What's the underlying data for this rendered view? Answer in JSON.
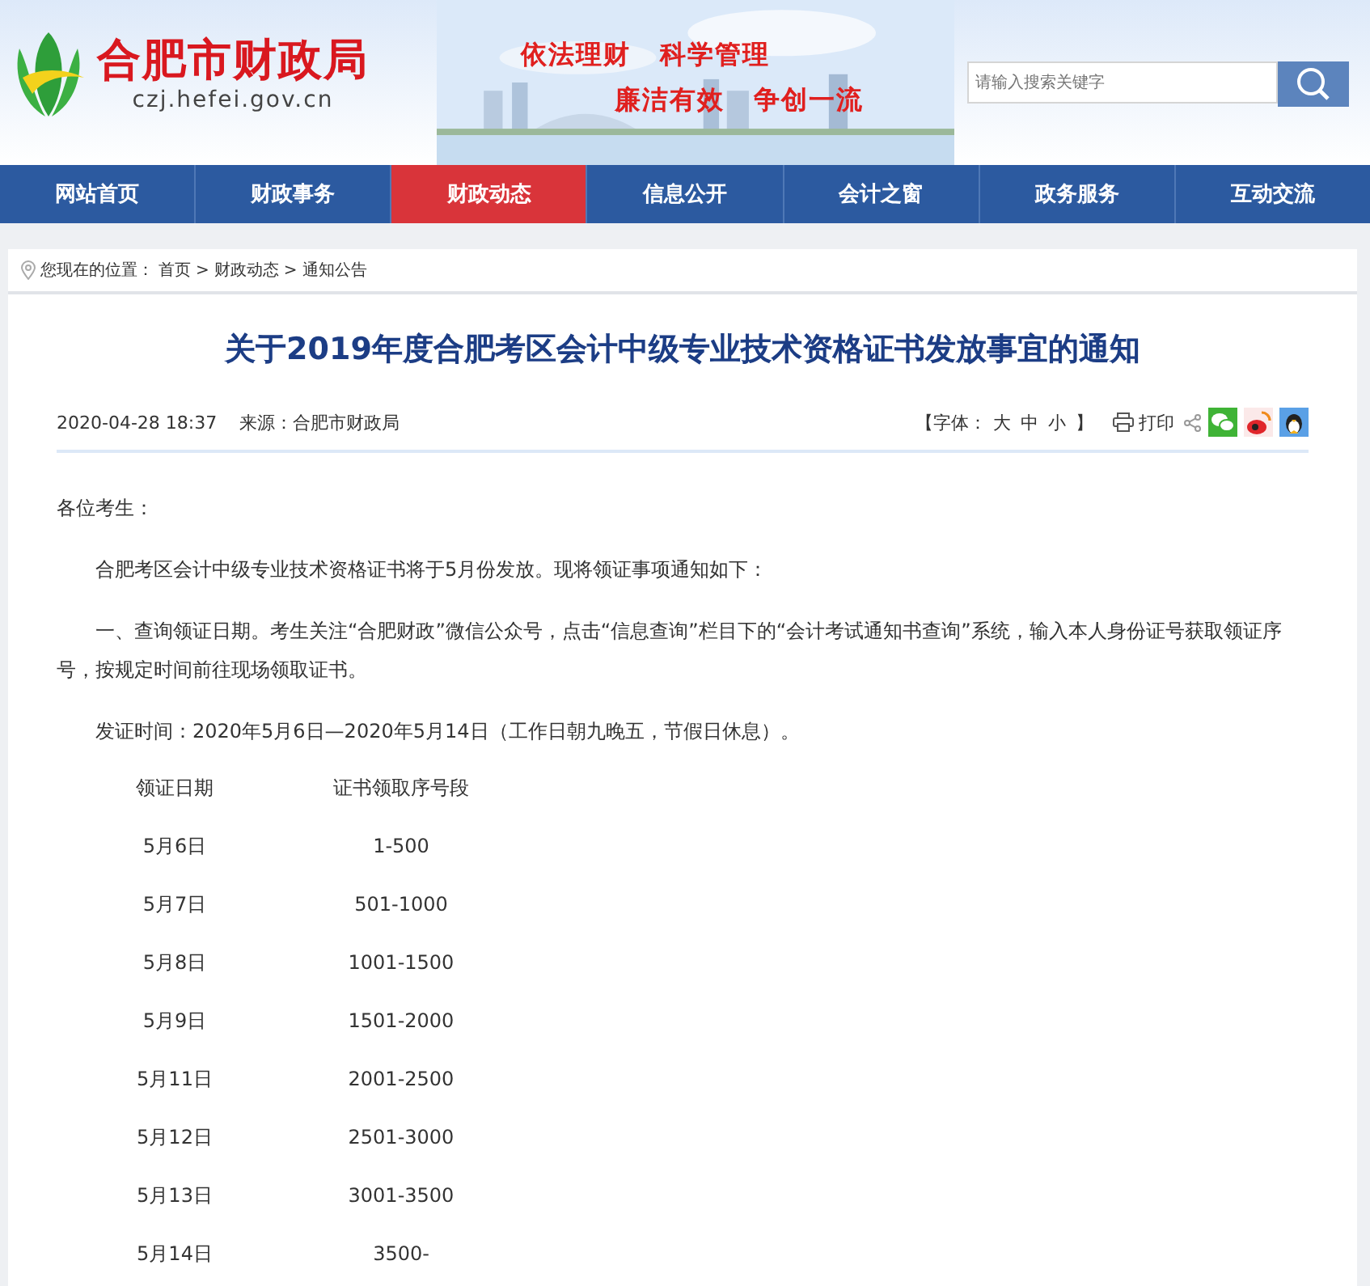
{
  "site": {
    "name": "合肥市财政局",
    "domain": "czj.hefei.gov.cn",
    "slogans": [
      "依法理财",
      "科学管理",
      "廉洁有效",
      "争创一流"
    ]
  },
  "search": {
    "placeholder": "请输入搜索关键字"
  },
  "nav": [
    {
      "label": "网站首页",
      "selected": false
    },
    {
      "label": "财政事务",
      "selected": false
    },
    {
      "label": "财政动态",
      "selected": true
    },
    {
      "label": "信息公开",
      "selected": false
    },
    {
      "label": "会计之窗",
      "selected": false
    },
    {
      "label": "政务服务",
      "selected": false
    },
    {
      "label": "互动交流",
      "selected": false
    }
  ],
  "breadcrumb": {
    "label": "您现在的位置：",
    "items": [
      "首页",
      "财政动态",
      "通知公告"
    ],
    "separator": ">"
  },
  "article": {
    "title": "关于2019年度合肥考区会计中级专业技术资格证书发放事宜的通知",
    "date": "2020-04-28 18:37",
    "source": "来源：合肥市财政局",
    "font_label": "【字体：",
    "font_sizes": [
      "大",
      "中",
      "小"
    ],
    "font_end": "】",
    "print": "打印",
    "paragraphs": [
      {
        "kind": "greeting",
        "text": "各位考生："
      },
      {
        "kind": "indent",
        "text": "合肥考区会计中级专业技术资格证书将于5月份发放。现将领证事项通知如下："
      },
      {
        "kind": "indent",
        "text": "一、查询领证日期。考生关注“合肥财政”微信公众号，点击“信息查询”栏目下的“会计考试通知书查询”系统，输入本人身份证号获取领证序号，按规定时间前往现场领取证书。"
      },
      {
        "kind": "indent",
        "text": "发证时间：2020年5月6日—2020年5月14日（工作日朝九晚五，节假日休息）。"
      }
    ],
    "table": {
      "columns": [
        "领证日期",
        "证书领取序号段"
      ],
      "rows": [
        [
          "5月6日",
          "1-500"
        ],
        [
          "5月7日",
          "501-1000"
        ],
        [
          "5月8日",
          "1001-1500"
        ],
        [
          "5月9日",
          "1501-2000"
        ],
        [
          "5月11日",
          "2001-2500"
        ],
        [
          "5月12日",
          "2501-3000"
        ],
        [
          "5月13日",
          "3001-3500"
        ],
        [
          "5月14日",
          "3500-"
        ]
      ]
    }
  }
}
